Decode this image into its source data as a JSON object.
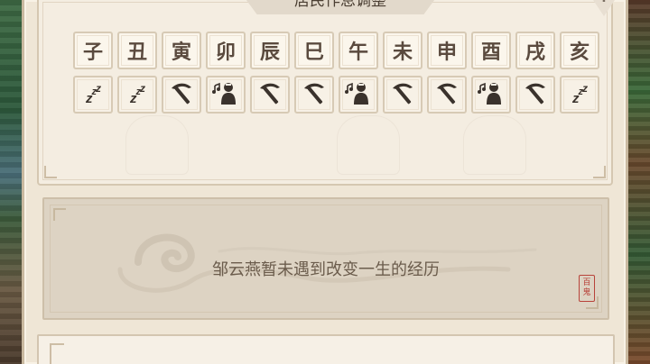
{
  "title": "居民作息调整",
  "alert_symbol": "!",
  "hours": [
    "子",
    "丑",
    "寅",
    "卯",
    "辰",
    "巳",
    "午",
    "未",
    "申",
    "酉",
    "戌",
    "亥"
  ],
  "activities": [
    {
      "type": "sleep",
      "icon": "sleep-icon"
    },
    {
      "type": "sleep",
      "icon": "sleep-icon"
    },
    {
      "type": "work",
      "icon": "pickaxe-icon"
    },
    {
      "type": "leisure",
      "icon": "music-person-icon"
    },
    {
      "type": "work",
      "icon": "pickaxe-icon"
    },
    {
      "type": "work",
      "icon": "pickaxe-icon"
    },
    {
      "type": "leisure",
      "icon": "music-person-icon"
    },
    {
      "type": "work",
      "icon": "pickaxe-icon"
    },
    {
      "type": "work",
      "icon": "pickaxe-icon"
    },
    {
      "type": "leisure",
      "icon": "music-person-icon"
    },
    {
      "type": "work",
      "icon": "pickaxe-icon"
    },
    {
      "type": "sleep",
      "icon": "sleep-icon"
    }
  ],
  "zzz_text": "z",
  "empty_message": "邹云燕暂未遇到改变一生的经历",
  "seal_text": "百鬼",
  "colors": {
    "panel_bg": "#efe6d6",
    "text_brown": "#5a4a3e",
    "seal_red": "#b8433a"
  }
}
